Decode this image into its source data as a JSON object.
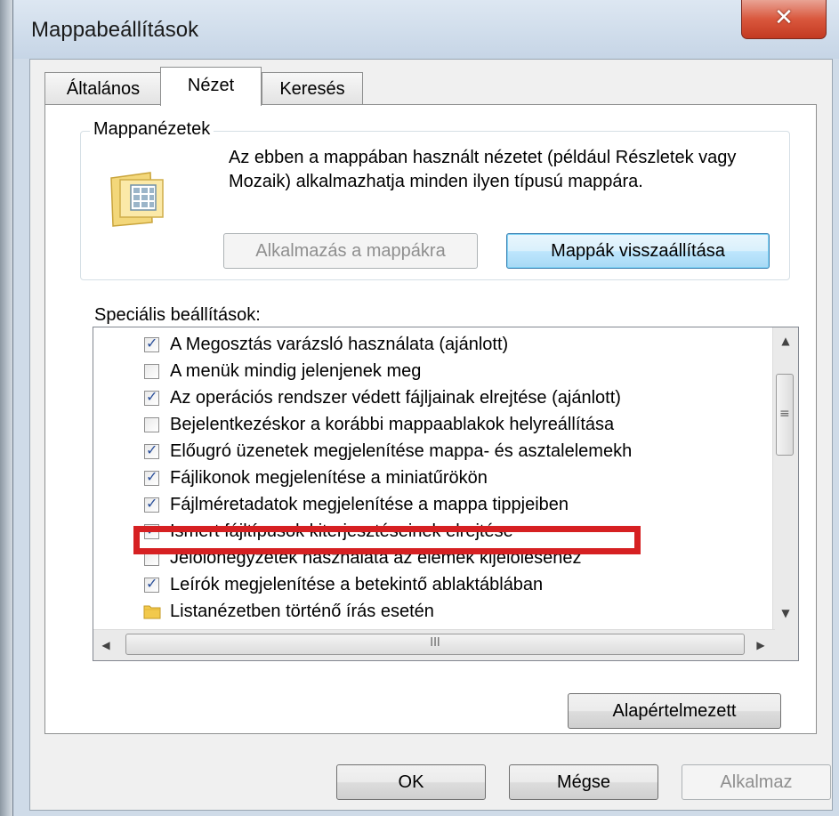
{
  "window": {
    "title": "Mappabeállítások",
    "close_glyph": "✕"
  },
  "tabs": [
    {
      "label": "Általános",
      "active": false
    },
    {
      "label": "Nézet",
      "active": true
    },
    {
      "label": "Keresés",
      "active": false
    }
  ],
  "folder_views": {
    "legend": "Mappanézetek",
    "icon": "folder-views-icon",
    "description": "Az ebben a mappában használt nézetet (például Részletek vagy Mozaik) alkalmazhatja minden ilyen típusú mappára.",
    "apply_button": "Alkalmazás a mappákra",
    "reset_button": "Mappák visszaállítása"
  },
  "advanced": {
    "label": "Speciális beállítások:",
    "items": [
      {
        "label": "A Megosztás varázsló használata (ajánlott)",
        "checked": true
      },
      {
        "label": "A menük mindig jelenjenek meg",
        "checked": false
      },
      {
        "label": "Az operációs rendszer védett fájljainak elrejtése (ajánlott)",
        "checked": true
      },
      {
        "label": "Bejelentkezéskor a korábbi mappaablakok helyreállítása",
        "checked": false
      },
      {
        "label": "Előugró üzenetek megjelenítése mappa- és asztalelemekh",
        "checked": true
      },
      {
        "label": "Fájlikonok megjelenítése a miniatűrökön",
        "checked": true
      },
      {
        "label": "Fájlméretadatok megjelenítése a mappa tippjeiben",
        "checked": true
      },
      {
        "label": "Ismert fájltípusok kiterjesztéseinek elrejtése",
        "checked": true
      },
      {
        "label": "Jelölőnégyzetek használata az elemek kijelöléséhez",
        "checked": false
      },
      {
        "label": "Leírók megjelenítése a betekintő ablaktáblában",
        "checked": true
      },
      {
        "label": "Listanézetben történő írás esetén",
        "checked": null,
        "icon": "folder-icon"
      }
    ],
    "hscroll_grip": "III",
    "vscroll_grip": "≡"
  },
  "defaults_button": "Alapértelmezett",
  "footer": {
    "ok": "OK",
    "cancel": "Mégse",
    "apply": "Alkalmaz"
  },
  "colors": {
    "highlight": "#d62022",
    "close": "#c33a22",
    "checkmark": "#2a4f9a"
  }
}
